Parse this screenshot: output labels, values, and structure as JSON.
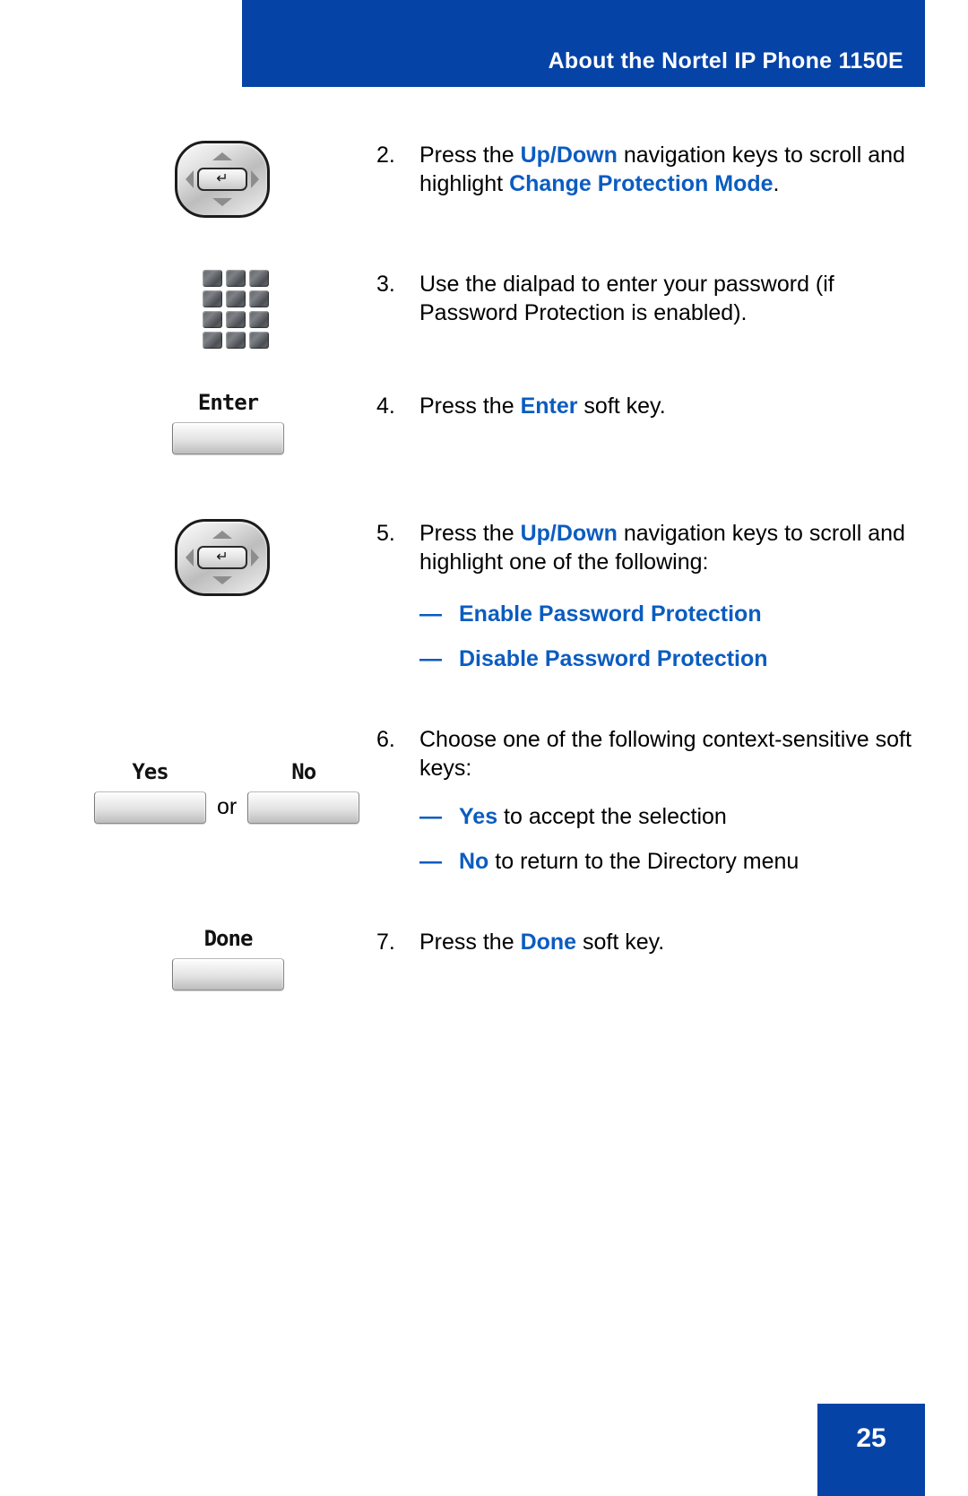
{
  "header": {
    "title": "About the Nortel IP Phone 1150E",
    "bar_color": "#0543a6"
  },
  "accent_color": "#0b5cc0",
  "steps": [
    {
      "number": "2.",
      "icon": "navigation-cluster-key",
      "text_parts": [
        {
          "t": "Press the ",
          "style": "plain"
        },
        {
          "t": "Up/Down",
          "style": "accent"
        },
        {
          "t": " navigation keys to scroll and highlight ",
          "style": "plain"
        },
        {
          "t": "Change Protection Mode",
          "style": "accent"
        },
        {
          "t": ".",
          "style": "plain"
        }
      ],
      "plain_text": "Press the Up/Down navigation keys to scroll and highlight Change Protection Mode."
    },
    {
      "number": "3.",
      "icon": "dialpad-keys",
      "text_parts": [
        {
          "t": "Use the dialpad to enter your password (if Password Protection is enabled).",
          "style": "plain"
        }
      ],
      "plain_text": "Use the dialpad to enter your password (if Password Protection is enabled)."
    },
    {
      "number": "4.",
      "icon": "soft-key",
      "softkey_label": "Enter",
      "text_parts": [
        {
          "t": "Press the ",
          "style": "plain"
        },
        {
          "t": "Enter",
          "style": "accent"
        },
        {
          "t": " soft key.",
          "style": "plain"
        }
      ],
      "plain_text": "Press the Enter soft key."
    },
    {
      "number": "5.",
      "icon": "navigation-cluster-key",
      "text_parts": [
        {
          "t": "Press the ",
          "style": "plain"
        },
        {
          "t": "Up/Down",
          "style": "accent"
        },
        {
          "t": " navigation keys to scroll and highlight one of the following:",
          "style": "plain"
        }
      ],
      "plain_text": "Press the Up/Down navigation keys to scroll and highlight one of the following:",
      "sub_items": [
        {
          "dash": "—",
          "label": "Enable Password Protection",
          "label_style": "accent",
          "rest": ""
        },
        {
          "dash": "—",
          "label": "Disable Password Protection",
          "label_style": "accent",
          "rest": ""
        }
      ]
    },
    {
      "number": "6.",
      "icon": "soft-key-pair",
      "softkey_label_left": "Yes",
      "softkey_label_right": "No",
      "or_text": "or",
      "text_parts": [
        {
          "t": "Choose one of the following context-sensitive soft keys:",
          "style": "plain"
        }
      ],
      "plain_text": "Choose one of the following context-sensitive soft keys:",
      "sub_items": [
        {
          "dash": "—",
          "label": "Yes",
          "label_style": "accent",
          "rest": " to accept the selection"
        },
        {
          "dash": "—",
          "label": "No",
          "label_style": "accent",
          "rest": " to return to the Directory menu"
        }
      ]
    },
    {
      "number": "7.",
      "icon": "soft-key",
      "softkey_label": "Done",
      "text_parts": [
        {
          "t": "Press the ",
          "style": "plain"
        },
        {
          "t": "Done",
          "style": "accent"
        },
        {
          "t": " soft key.",
          "style": "plain"
        }
      ],
      "plain_text": "Press the Done soft key."
    }
  ],
  "footer": {
    "page_number": "25"
  },
  "icons": {
    "nav_enter_glyph": "↵"
  }
}
